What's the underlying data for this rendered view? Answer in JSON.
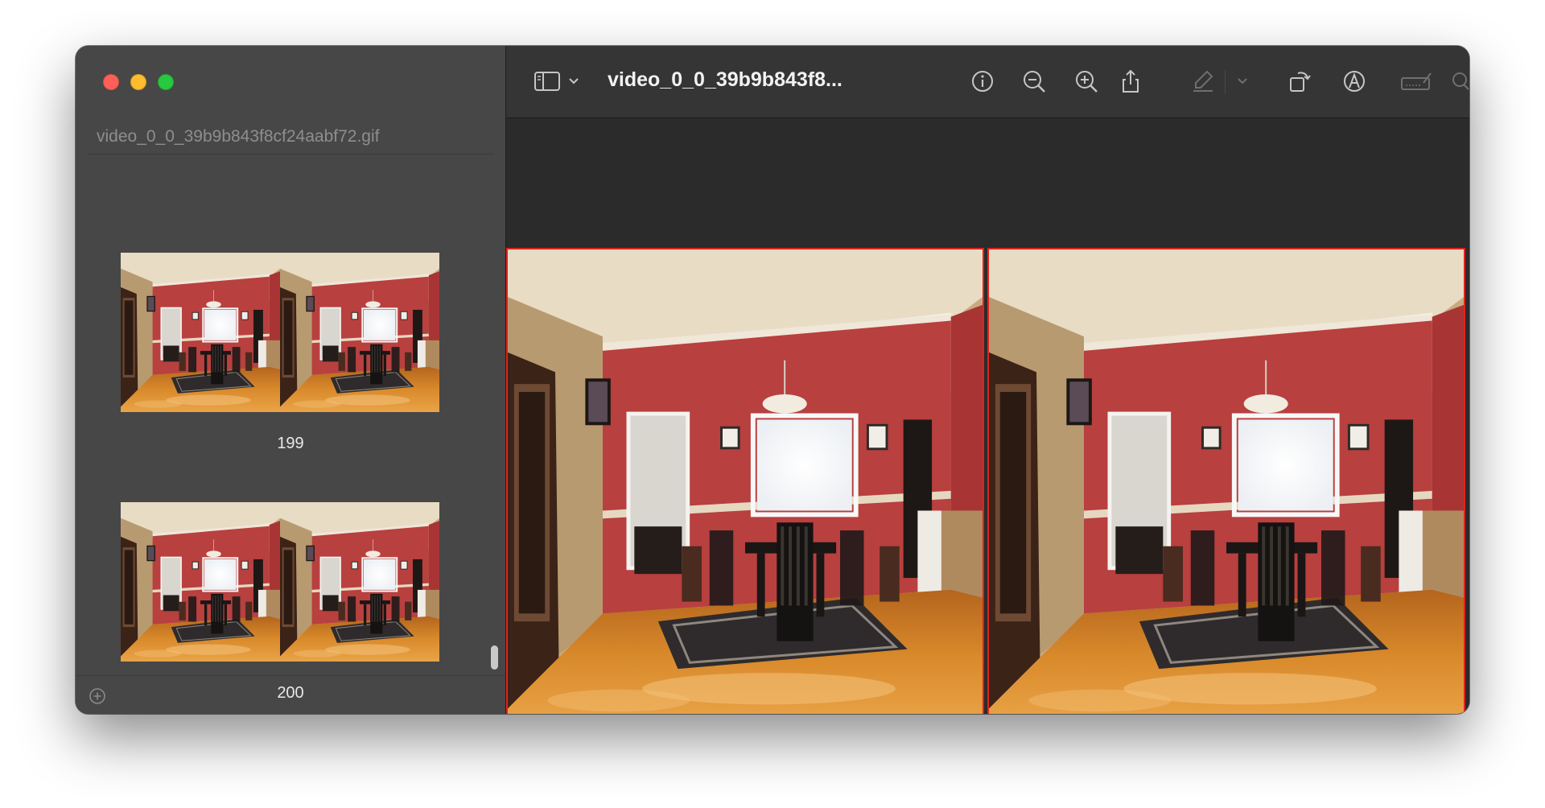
{
  "window": {
    "traffic_lights": {
      "close_color": "#fe5f57",
      "minimize_color": "#febc2e",
      "zoom_color": "#28c840"
    }
  },
  "sidebar": {
    "title": "video_0_0_39b9b843f8cf24aabf72.gif",
    "thumbnails": [
      {
        "label": "199"
      },
      {
        "label": "200"
      }
    ],
    "add_icon": "plus-circle-icon"
  },
  "toolbar": {
    "title": "video_0_0_39b9b843f8...",
    "icons": [
      "sidebar-toggle-icon",
      "chevron-down-icon",
      "info-icon",
      "zoom-out-icon",
      "zoom-in-icon",
      "share-icon",
      "highlight-pen-icon",
      "chevron-down-icon",
      "rotate-icon",
      "markup-icon",
      "sign-icon",
      "search-icon"
    ]
  },
  "viewer": {
    "frame_border_color": "#e3211c",
    "frames": 2
  }
}
